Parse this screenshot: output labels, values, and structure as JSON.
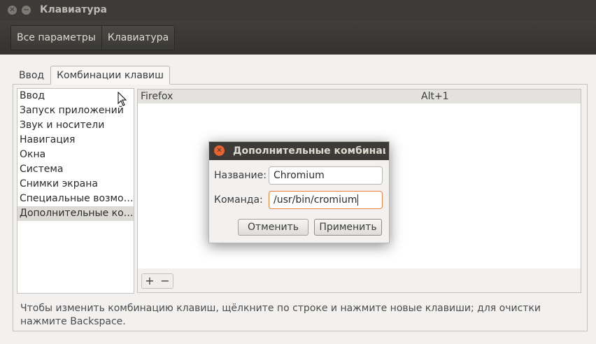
{
  "window": {
    "title": "Клавиатура"
  },
  "toolbar": {
    "crumbs": [
      "Все параметры",
      "Клавиатура"
    ]
  },
  "tabs": [
    "Ввод",
    "Комбинации клавиш"
  ],
  "categories": [
    "Ввод",
    "Запуск приложений",
    "Звук и носители",
    "Навигация",
    "Окна",
    "Система",
    "Снимки экрана",
    "Специальные возмо…",
    "Дополнительные ко…"
  ],
  "shortcuts": [
    {
      "name": "Firefox",
      "key": "Alt+1"
    }
  ],
  "buttons": {
    "add": "+",
    "remove": "−"
  },
  "hint": "Чтобы изменить комбинацию клавиш, щёлкните по строке и нажмите новые клавиши; для очистки нажмите Backspace.",
  "dialog": {
    "title": "Дополнительные комбинации",
    "name_label": "Название:",
    "name_value": "Chromium",
    "command_label": "Команда:",
    "command_value": "/usr/bin/cromium",
    "cancel": "Отменить",
    "apply": "Применить"
  }
}
